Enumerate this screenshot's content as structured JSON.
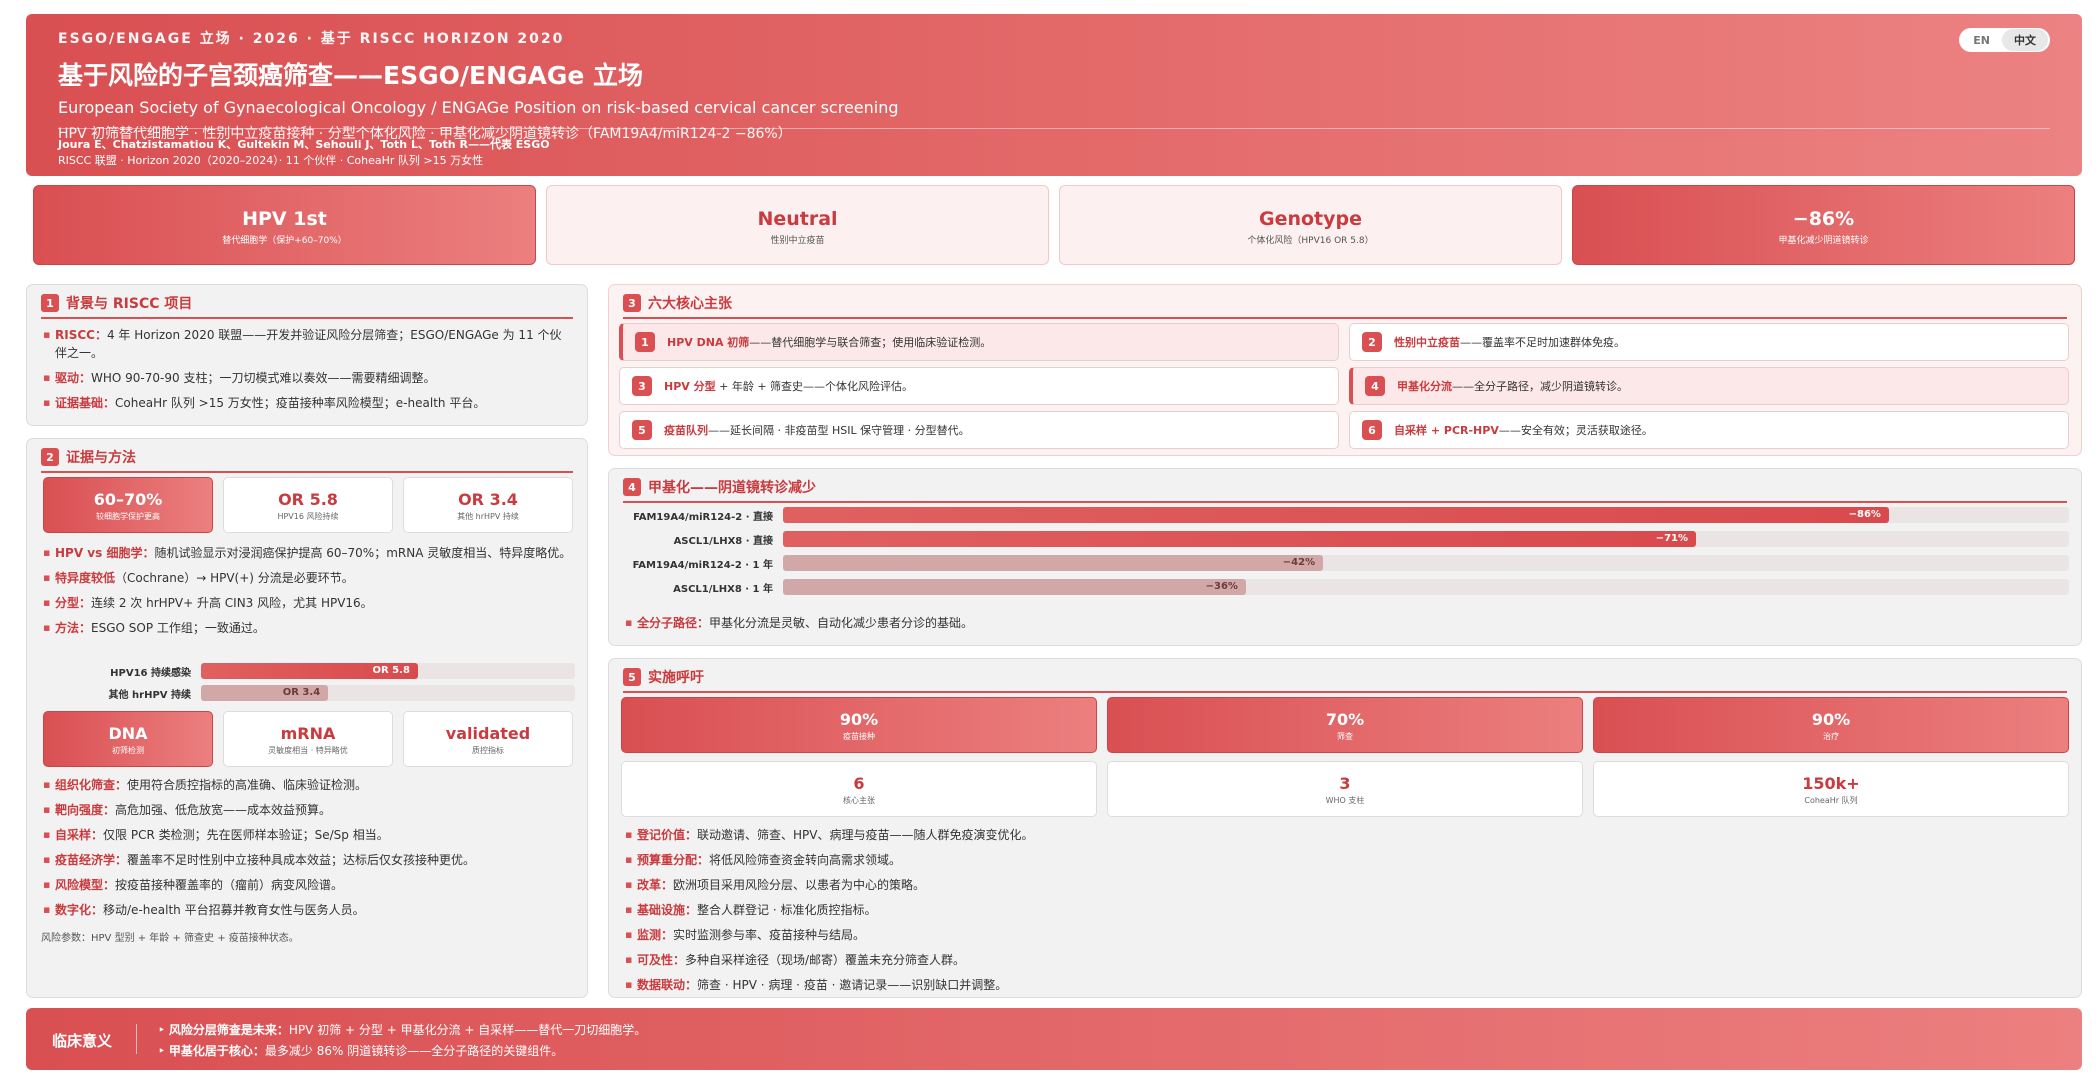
{
  "header": {
    "kicker": "ESGO/ENGAGE 立场 · 2026 · 基于 RISCC HORIZON 2020",
    "title": "基于风险的子宫颈癌筛查——ESGO/ENGAGe 立场",
    "subtitle": "European Society of Gynaecological Oncology / ENGAGe Position on risk-based cervical cancer screening",
    "tagline": "HPV 初筛替代细胞学 · 性别中立疫苗接种 · 分型个体化风险 · 甲基化减少阴道镜转诊（FAM19A4/miR124-2 −86%）",
    "authors": "Joura E、Chatzistamatiou K、Gultekin M、Sehouli J、Toth L、Toth R——代表 ESGO",
    "consortium": "RISCC 联盟 · Horizon 2020（2020–2024）· 11 个伙伴 · CoheaHr 队列 >15 万女性",
    "lang": [
      "EN",
      "中文"
    ],
    "lang_active": "中文"
  },
  "stats": [
    {
      "value": "HPV 1st",
      "label": "替代细胞学（保护+60–70%）"
    },
    {
      "value": "Neutral",
      "label": "性别中立疫苗"
    },
    {
      "value": "Genotype",
      "label": "个体化风险（HPV16 OR 5.8）"
    },
    {
      "value": "−86%",
      "label": "甲基化减少阴道镜转诊"
    }
  ],
  "s1": {
    "num": "1",
    "title": "背景与 RISCC 项目",
    "bullets": [
      {
        "k": "RISCC：",
        "t": "4 年 Horizon 2020 联盟——开发并验证风险分层筛查；ESGO/ENGAGe 为 11 个伙伴之一。"
      },
      {
        "k": "驱动：",
        "t": "WHO 90-70-90 支柱；一刀切模式难以奏效——需要精细调整。"
      },
      {
        "k": "证据基础：",
        "t": "CoheaHr 队列 >15 万女性；疫苗接种率风险模型；e-health 平台。"
      }
    ]
  },
  "s2": {
    "num": "2",
    "title": "证据与方法",
    "cards1": [
      {
        "value": "60–70%",
        "label": "较细胞学保护更高"
      },
      {
        "value": "OR 5.8",
        "label": "HPV16 风险持续"
      },
      {
        "value": "OR 3.4",
        "label": "其他 hrHPV 持续"
      }
    ],
    "bullets1": [
      {
        "k": "HPV vs 细胞学：",
        "t": "随机试验显示对浸润癌保护提高 60–70%；mRNA 灵敏度相当、特异度略优。"
      },
      {
        "k": "特异度较低",
        "t": "（Cochrane）→ HPV(+) 分流是必要环节。"
      },
      {
        "k": "分型：",
        "t": "连续 2 次 hrHPV+ 升高 CIN3 风险，尤其 HPV16。"
      },
      {
        "k": "方法：",
        "t": "ESGO SOP 工作组；一致通过。"
      }
    ],
    "bars": [
      {
        "label": "HPV16 持续感染",
        "value": 5.8,
        "text": "OR 5.8"
      },
      {
        "label": "其他 hrHPV 持续",
        "value": 3.4,
        "text": "OR 3.4"
      }
    ],
    "cards2": [
      {
        "value": "DNA",
        "label": "初筛检测"
      },
      {
        "value": "mRNA",
        "label": "灵敏度相当 · 特异略优"
      },
      {
        "value": "validated",
        "label": "质控指标"
      }
    ],
    "bullets2": [
      {
        "k": "组织化筛查：",
        "t": "使用符合质控指标的高准确、临床验证检测。"
      },
      {
        "k": "靶向强度：",
        "t": "高危加强、低危放宽——成本效益预算。"
      },
      {
        "k": "自采样：",
        "t": "仅限 PCR 类检测；先在医师样本验证；Se/Sp 相当。"
      },
      {
        "k": "疫苗经济学：",
        "t": "覆盖率不足时性别中立接种具成本效益；达标后仅女孩接种更优。"
      },
      {
        "k": "风险模型：",
        "t": "按疫苗接种覆盖率的（瘤前）病变风险谱。"
      },
      {
        "k": "数字化：",
        "t": "移动/e-health 平台招募并教育女性与医务人员。"
      }
    ],
    "note": "风险参数：HPV 型别 + 年龄 + 筛查史 + 疫苗接种状态。"
  },
  "s3": {
    "num": "3",
    "title": "六大核心主张",
    "items": [
      {
        "n": "1",
        "k": "HPV DNA 初筛",
        "t": "——替代细胞学与联合筛查；使用临床验证检测。",
        "hl": true
      },
      {
        "n": "2",
        "k": "性别中立疫苗",
        "t": "——覆盖率不足时加速群体免疫。",
        "hl": false
      },
      {
        "n": "3",
        "k": "HPV 分型",
        "t": " + 年龄 + 筛查史——个体化风险评估。",
        "hl": false
      },
      {
        "n": "4",
        "k": "甲基化分流",
        "t": "——全分子路径，减少阴道镜转诊。",
        "hl": true
      },
      {
        "n": "5",
        "k": "疫苗队列",
        "t": "——延长间隔 · 非疫苗型 HSIL 保守管理 · 分型替代。",
        "hl": false
      },
      {
        "n": "6",
        "k": "自采样 + PCR-HPV",
        "t": "——安全有效；灵活获取途径。",
        "hl": false
      }
    ]
  },
  "s4": {
    "num": "4",
    "title": "甲基化——阴道镜转诊减少",
    "bars": [
      {
        "label": "FAM19A4/miR124-2 · 直接",
        "value": 86,
        "text": "−86%",
        "style": "red"
      },
      {
        "label": "ASCL1/LHX8 · 直接",
        "value": 71,
        "text": "−71%",
        "style": "red"
      },
      {
        "label": "FAM19A4/miR124-2 · 1 年",
        "value": 42,
        "text": "−42%",
        "style": "pink"
      },
      {
        "label": "ASCL1/LHX8 · 1 年",
        "value": 36,
        "text": "−36%",
        "style": "pink"
      }
    ],
    "bullet": {
      "k": "全分子路径：",
      "t": "甲基化分流是灵敏、自动化减少患者分诊的基础。"
    }
  },
  "s5": {
    "num": "5",
    "title": "实施呼吁",
    "targets": [
      {
        "value": "90%",
        "label": "疫苗接种"
      },
      {
        "value": "70%",
        "label": "筛查"
      },
      {
        "value": "90%",
        "label": "治疗"
      }
    ],
    "counts": [
      {
        "value": "6",
        "label": "核心主张"
      },
      {
        "value": "3",
        "label": "WHO 支柱"
      },
      {
        "value": "150k+",
        "label": "CoheaHr 队列"
      }
    ],
    "bullets": [
      {
        "k": "登记价值：",
        "t": "联动邀请、筛查、HPV、病理与疫苗——随人群免疫演变优化。"
      },
      {
        "k": "预算重分配：",
        "t": "将低风险筛查资金转向高需求领域。"
      },
      {
        "k": "改革：",
        "t": "欧洲项目采用风险分层、以患者为中心的策略。"
      },
      {
        "k": "基础设施：",
        "t": "整合人群登记 · 标准化质控指标。"
      },
      {
        "k": "监测：",
        "t": "实时监测参与率、疫苗接种与结局。"
      },
      {
        "k": "可及性：",
        "t": "多种自采样途径（现场/邮寄）覆盖未充分筛查人群。"
      },
      {
        "k": "数据联动：",
        "t": "筛查 · HPV · 病理 · 疫苗 · 邀请记录——识别缺口并调整。"
      }
    ]
  },
  "footer": {
    "title": "临床意义",
    "lines": [
      {
        "k": "风险分层筛查是未来：",
        "t": "HPV 初筛 + 分型 + 甲基化分流 + 自采样——替代一刀切细胞学。"
      },
      {
        "k": "甲基化居于核心：",
        "t": "最多减少 86% 阴道镜转诊——全分子路径的关键组件。"
      }
    ]
  },
  "colors": {
    "accent": "#d94f52",
    "accent_light": "#ec7f7f",
    "panel_bg": "#f2f2f2"
  }
}
